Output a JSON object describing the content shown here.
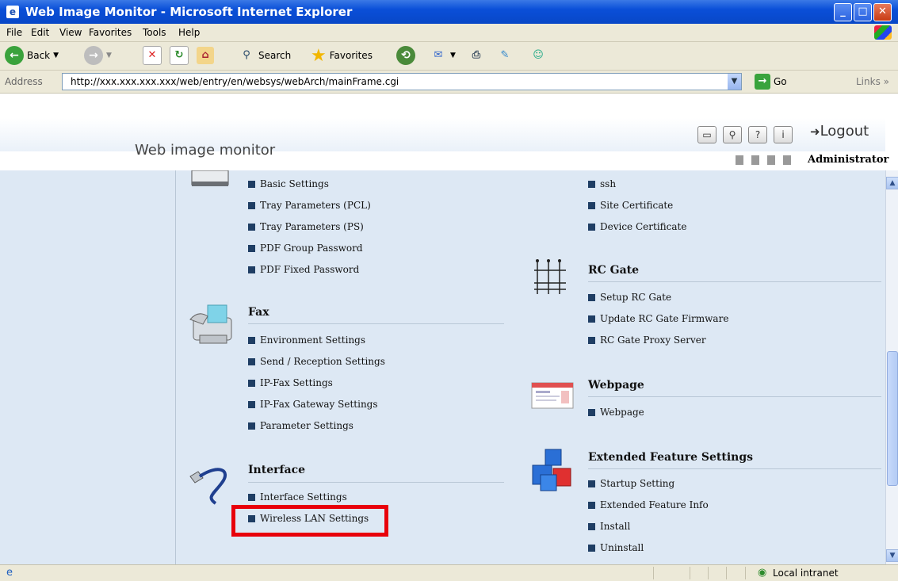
{
  "window": {
    "title": "Web Image Monitor - Microsoft Internet Explorer"
  },
  "menu": [
    "File",
    "Edit",
    "View",
    "Favorites",
    "Tools",
    "Help"
  ],
  "toolbar": {
    "back": "Back",
    "search": "Search",
    "favorites": "Favorites"
  },
  "address": {
    "label": "Address",
    "url": "http://xxx.xxx.xxx.xxx/web/entry/en/websys/webArch/mainFrame.cgi",
    "go": "Go",
    "links": "Links"
  },
  "header": {
    "brand": "Web image monitor",
    "logout": "Logout",
    "user": "Administrator"
  },
  "left": {
    "printer_items": [
      "Basic Settings",
      "Tray Parameters (PCL)",
      "Tray Parameters (PS)",
      "PDF Group Password",
      "PDF Fixed Password"
    ],
    "fax": {
      "title": "Fax",
      "items": [
        "Environment Settings",
        "Send / Reception Settings",
        "IP-Fax Settings",
        "IP-Fax Gateway Settings",
        "Parameter Settings"
      ]
    },
    "interface": {
      "title": "Interface",
      "items": [
        "Interface Settings",
        "Wireless LAN Settings"
      ]
    }
  },
  "right": {
    "security_items": [
      "ssh",
      "Site Certificate",
      "Device Certificate"
    ],
    "rcgate": {
      "title": "RC Gate",
      "items": [
        "Setup RC Gate",
        "Update RC Gate Firmware",
        "RC Gate Proxy Server"
      ]
    },
    "webpage": {
      "title": "Webpage",
      "items": [
        "Webpage"
      ]
    },
    "extended": {
      "title": "Extended Feature Settings",
      "items": [
        "Startup Setting",
        "Extended Feature Info",
        "Install",
        "Uninstall"
      ]
    }
  },
  "status": {
    "zone": "Local intranet"
  },
  "colors": {
    "highlight": "#e8000b",
    "content_bg": "#dde8f4",
    "titlebar": "#0a4fd8"
  }
}
